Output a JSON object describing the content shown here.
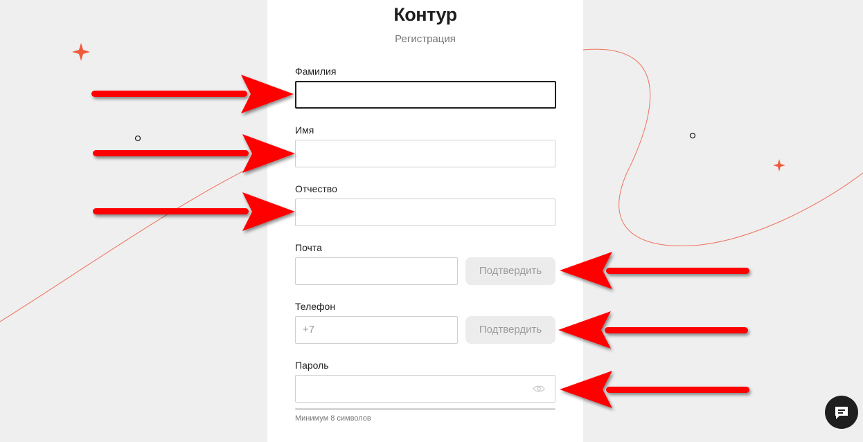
{
  "header": {
    "logo": "Контур",
    "subtitle": "Регистрация"
  },
  "form": {
    "lastname": {
      "label": "Фамилия",
      "value": "",
      "placeholder": ""
    },
    "firstname": {
      "label": "Имя",
      "value": "",
      "placeholder": ""
    },
    "patronymic": {
      "label": "Отчество",
      "value": "",
      "placeholder": ""
    },
    "email": {
      "label": "Почта",
      "value": "",
      "placeholder": "",
      "confirm_label": "Подтвердить"
    },
    "phone": {
      "label": "Телефон",
      "value": "",
      "placeholder": "+7",
      "confirm_label": "Подтвердить"
    },
    "password": {
      "label": "Пароль",
      "value": "",
      "placeholder": "",
      "hint": "Минимум 8 символов"
    }
  },
  "icons": {
    "password_visibility": "eye-icon",
    "chat": "chat-icon",
    "decor": [
      "sparkle-icon",
      "circle-icon"
    ]
  },
  "colors": {
    "accent": "#f05a3c",
    "annotation_arrow": "#ff0000",
    "chat_button": "#1f1f1f",
    "background": "#efefef"
  }
}
